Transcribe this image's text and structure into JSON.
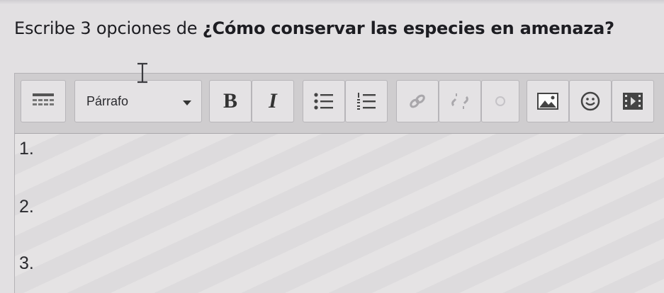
{
  "question": {
    "prefix": "Escribe 3 opciones de ",
    "highlight": "¿Cómo conservar las especies en amenaza?"
  },
  "toolbar": {
    "format_select": {
      "value": "Párrafo"
    },
    "bold_label": "B",
    "italic_label": "I",
    "icons": [
      "toolbar-toggle-icon",
      "bullet-list-icon",
      "numbered-list-icon",
      "link-icon",
      "unlink-icon",
      "image-icon",
      "emoji-icon",
      "media-icon"
    ]
  },
  "answer": {
    "lines": [
      "1.",
      "2.",
      "3."
    ]
  }
}
